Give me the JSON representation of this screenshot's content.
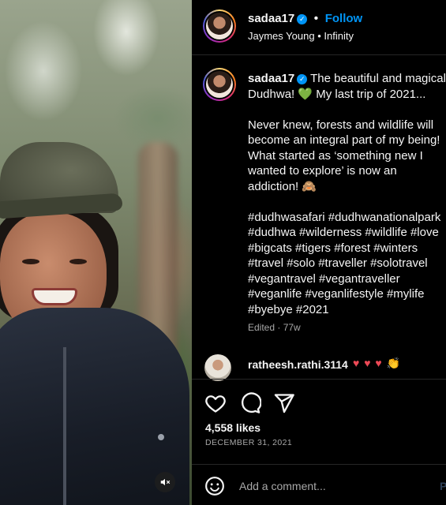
{
  "header": {
    "username": "sadaa17",
    "separator": "•",
    "follow_label": "Follow",
    "audio_artist": "Jaymes Young",
    "audio_sep": "•",
    "audio_track": "Infinity"
  },
  "caption": {
    "username": "sadaa17",
    "line1": "The beautiful and magical Dudhwa! 💚  My last trip of 2021...",
    "line2": "Never knew, forests and wildlife will become an integral part of my being! What started as ‘something new I wanted to explore’ is now an addiction! 🙈",
    "hashtags": "#dudhwasafari #dudhwanationalpark #dudhwa #wilderness #wildlife #love #bigcats #tigers #forest #winters #travel #solo #traveller #solotravel #vegantravel #vegantraveller #veganlife #veganlifestyle #mylife #byebye #2021",
    "meta": "Edited · 77w"
  },
  "comments": [
    {
      "username": "ratheesh.rathi.3114",
      "text": "♥ ♥ ♥ 👏"
    }
  ],
  "stats": {
    "likes": "4,558 likes",
    "date": "DECEMBER 31, 2021"
  },
  "add_comment": {
    "placeholder": "Add a comment...",
    "post_label": "P"
  },
  "icons": {
    "verified": "verified-badge-icon",
    "like": "heart-icon",
    "comment": "comment-bubble-icon",
    "share": "paper-plane-icon",
    "emoji": "smiley-icon",
    "mute": "speaker-muted-icon"
  },
  "colors": {
    "link": "#0095f6",
    "heart": "#ed4956",
    "muted_text": "#a8a8a8",
    "divider": "#262626"
  }
}
